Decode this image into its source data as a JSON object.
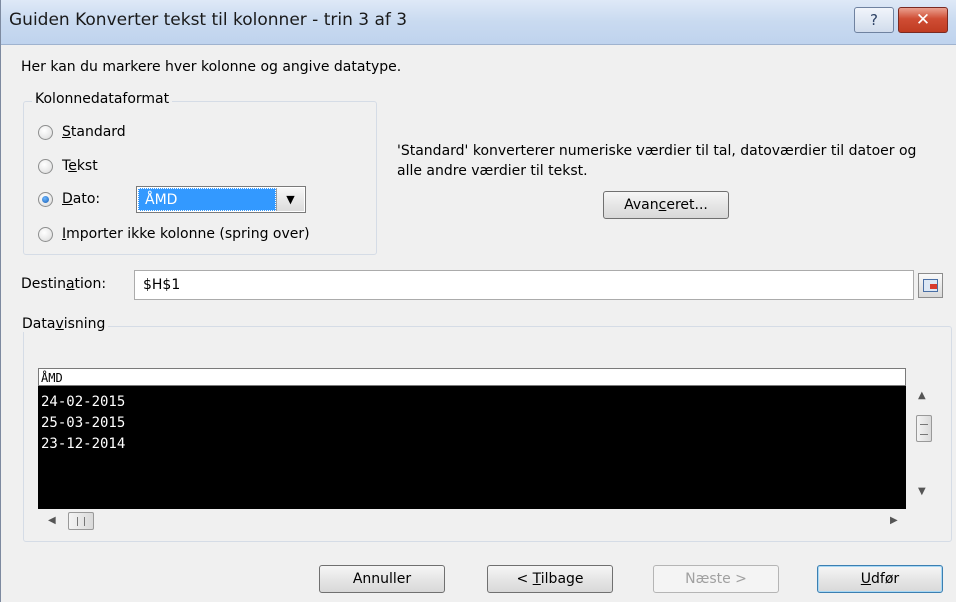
{
  "window": {
    "title": "Guiden Konverter tekst til kolonner - trin 3 af 3",
    "help_label": "?",
    "close_label": "✕"
  },
  "intro": "Her kan du markere hver kolonne og angive datatype.",
  "column_format": {
    "legend": "Kolonnedataformat",
    "options": [
      {
        "label_accel": "S",
        "label_rest": "tandard",
        "checked": false
      },
      {
        "label_pre": "T",
        "label_accel": "e",
        "label_rest": "kst",
        "checked": false
      },
      {
        "label_accel": "D",
        "label_rest": "ato:",
        "checked": true
      },
      {
        "label_accel": "I",
        "label_rest": "mporter ikke kolonne (spring over)",
        "checked": false
      }
    ],
    "date_select_value": "ÅMD"
  },
  "description": "'Standard' konverterer numeriske værdier til tal, datoværdier til datoer og alle andre værdier til tekst.",
  "advanced_button": {
    "pre": "Avan",
    "accel": "c",
    "rest": "eret..."
  },
  "destination": {
    "label_pre": "Destin",
    "label_accel": "a",
    "label_rest": "tion:",
    "value": "$H$1"
  },
  "preview": {
    "legend_pre": "Data",
    "legend_accel": "v",
    "legend_rest": "isning",
    "header": "ÅMD",
    "rows": [
      "24-02-2015",
      "25-03-2015",
      "23-12-2014"
    ]
  },
  "buttons": {
    "cancel": "Annuller",
    "back_pre": "< ",
    "back_accel": "T",
    "back_rest": "ilbage",
    "next": "Næste >",
    "finish_accel": "U",
    "finish_rest": "dfør"
  }
}
